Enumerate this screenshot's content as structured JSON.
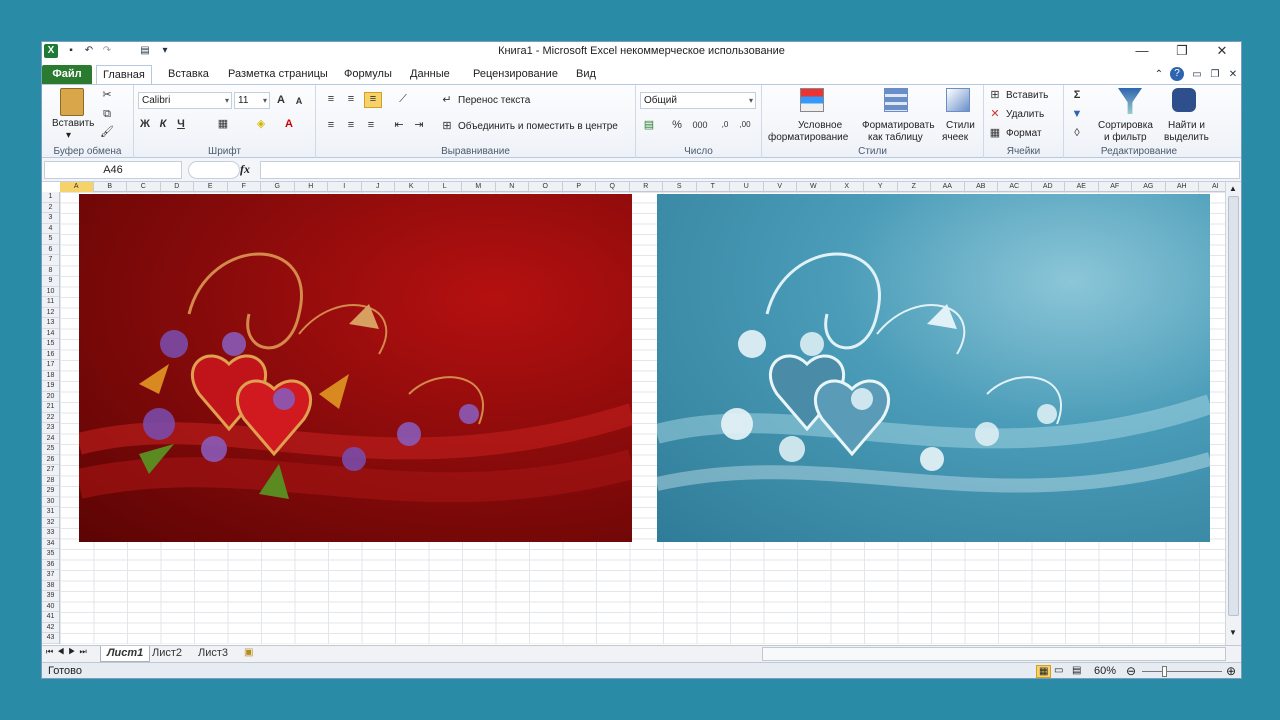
{
  "window": {
    "title": "Книга1  -  Microsoft Excel некоммерческое использование",
    "buttons": [
      "minimize",
      "restore",
      "close"
    ]
  },
  "ribbon_tabs": [
    "Файл",
    "Главная",
    "Вставка",
    "Разметка страницы",
    "Формулы",
    "Данные",
    "Рецензирование",
    "Вид"
  ],
  "active_tab": "Главная",
  "clipboard": {
    "paste": "Вставить",
    "label": "Буфер обмена"
  },
  "font": {
    "name": "Calibri",
    "size": "11",
    "label": "Шрифт",
    "bold": "Ж",
    "italic": "К",
    "underline": "Ч"
  },
  "alignment": {
    "wrap": "Перенос текста",
    "merge": "Объединить и поместить в центре",
    "label": "Выравнивание"
  },
  "number": {
    "format": "Общий",
    "label": "Число",
    "percent": "%",
    "thousands": "000"
  },
  "styles": {
    "conditional1": "Условное",
    "conditional2": "форматирование",
    "table1": "Форматировать",
    "table2": "как таблицу",
    "cell1": "Стили",
    "cell2": "ячеек",
    "label": "Стили"
  },
  "cells": {
    "insert": "Вставить",
    "delete": "Удалить",
    "format": "Формат",
    "label": "Ячейки"
  },
  "editing": {
    "sort1": "Сортировка",
    "sort2": "и фильтр",
    "find1": "Найти и",
    "find2": "выделить",
    "label": "Редактирование",
    "sigma": "Σ"
  },
  "formula_bar": {
    "namebox": "A46",
    "fx": "fx",
    "content": ""
  },
  "columns": [
    "A",
    "B",
    "C",
    "D",
    "E",
    "F",
    "G",
    "H",
    "I",
    "J",
    "K",
    "L",
    "M",
    "N",
    "O",
    "P",
    "Q",
    "R",
    "S",
    "T",
    "U",
    "V",
    "W",
    "X",
    "Y",
    "Z",
    "AA",
    "AB",
    "AC",
    "AD",
    "AE",
    "AF",
    "AG",
    "AH",
    "AI"
  ],
  "rows": [
    "1",
    "2",
    "3",
    "4",
    "5",
    "6",
    "7",
    "8",
    "9",
    "10",
    "11",
    "12",
    "13",
    "14",
    "15",
    "16",
    "17",
    "18",
    "19",
    "20",
    "21",
    "22",
    "23",
    "24",
    "25",
    "26",
    "27",
    "28",
    "29",
    "30",
    "31",
    "32",
    "33",
    "34",
    "35",
    "36",
    "37",
    "38",
    "39",
    "40",
    "41",
    "42",
    "43"
  ],
  "sheets": [
    "Лист1",
    "Лист2",
    "Лист3"
  ],
  "active_sheet": "Лист1",
  "status": {
    "ready": "Готово",
    "zoom": "60%"
  },
  "colors": {
    "file_tab": "#2a7a30",
    "red_card": "#8b0b0b",
    "teal_card": "#2f8aa7"
  }
}
